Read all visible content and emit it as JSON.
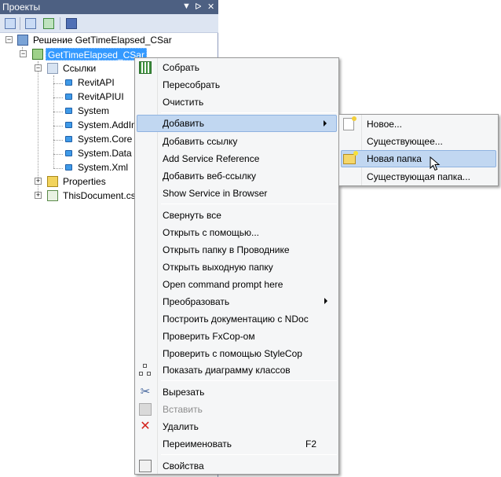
{
  "panel": {
    "title": "Проекты",
    "title_buttons": [
      "▼",
      "ᐅ",
      "✕"
    ]
  },
  "tree": {
    "solution": "Решение GetTimeElapsed_CSar",
    "project": "GetTimeElapsed_CSar",
    "references_folder": "Ссылки",
    "references": [
      "RevitAPI",
      "RevitAPIUI",
      "System",
      "System.AddIn",
      "System.Core",
      "System.Data",
      "System.Xml"
    ],
    "properties": "Properties",
    "document": "ThisDocument.cs"
  },
  "context_menu": {
    "build": "Собрать",
    "rebuild": "Пересобрать",
    "clean": "Очистить",
    "add": "Добавить",
    "add_reference": "Добавить ссылку",
    "add_service_reference": "Add Service Reference",
    "add_web_reference": "Добавить веб-ссылку",
    "show_service_in_browser": "Show Service in Browser",
    "collapse_all": "Свернуть все",
    "open_with": "Открыть с помощью...",
    "open_folder_in_explorer": "Открыть папку в Проводнике",
    "open_output_folder": "Открыть выходную папку",
    "open_command_prompt": "Open command prompt here",
    "convert": "Преобразовать",
    "build_docs_ndoc": "Построить документацию с NDoc",
    "check_fxcop": "Проверить FxCop-ом",
    "check_stylecop": "Проверить с помощью StyleCop",
    "show_class_diagram": "Показать диаграмму классов",
    "cut": "Вырезать",
    "paste": "Вставить",
    "delete": "Удалить",
    "rename": "Переименовать",
    "rename_shortcut": "F2",
    "properties": "Свойства"
  },
  "submenu": {
    "new": "Новое...",
    "existing": "Существующее...",
    "new_folder": "Новая папка",
    "existing_folder": "Существующая папка..."
  },
  "colors": {
    "title_bar": "#4d6082",
    "selection": "#3399ff",
    "menu_hover": "#c1d7f1"
  }
}
